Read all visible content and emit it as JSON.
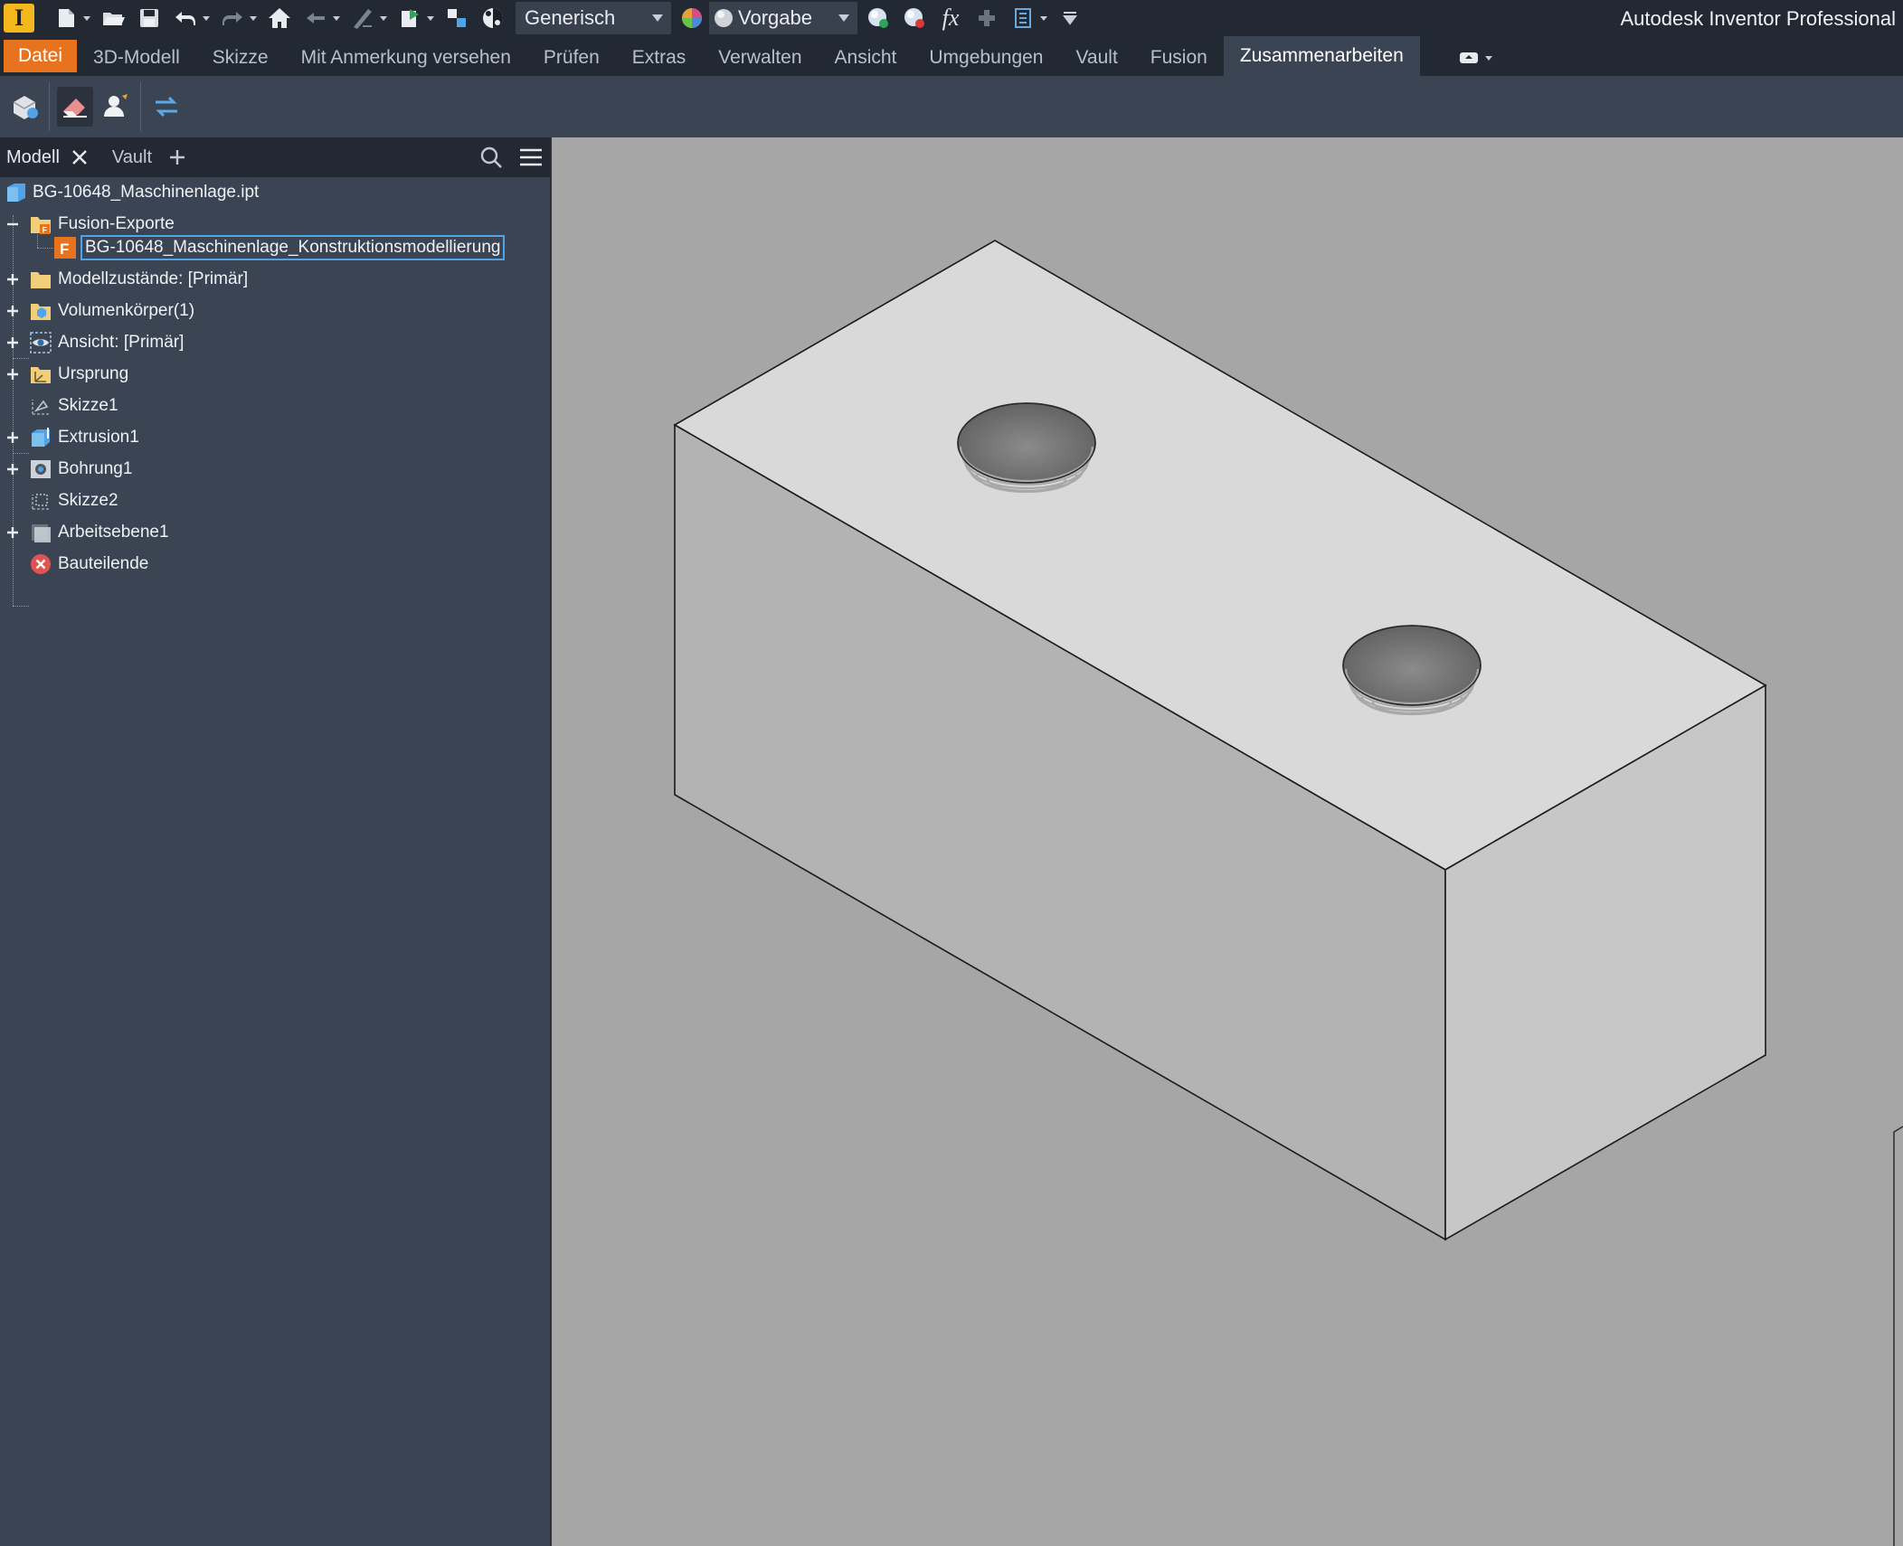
{
  "app": {
    "logo_letter": "I",
    "title": "Autodesk Inventor Professional"
  },
  "quick_access": {
    "appearance_combo": "Generisch",
    "material_combo": "Vorgabe",
    "fx_label": "fx"
  },
  "ribbon": {
    "tabs": [
      "Datei",
      "3D-Modell",
      "Skizze",
      "Mit Anmerkung versehen",
      "Prüfen",
      "Extras",
      "Verwalten",
      "Ansicht",
      "Umgebungen",
      "Vault",
      "Fusion",
      "Zusammenarbeiten"
    ],
    "active_tab": "Zusammenarbeiten"
  },
  "browser": {
    "tabs": [
      "Modell",
      "Vault"
    ],
    "tree": {
      "root": "BG-10648_Maschinenlage.ipt",
      "fusion_folder": "Fusion-Exporte",
      "fusion_item": "BG-10648_Maschinenlage_Konstruktionsmodellierung",
      "model_states": "Modellzustände: [Primär]",
      "solid_bodies": "Volumenkörper(1)",
      "view": "Ansicht: [Primär]",
      "origin": "Ursprung",
      "sketch1": "Skizze1",
      "extrusion1": "Extrusion1",
      "hole1": "Bohrung1",
      "sketch2": "Skizze2",
      "workplane1": "Arbeitsebene1",
      "end_of_part": "Bauteilende"
    }
  },
  "colors": {
    "title_bar": "#222933",
    "panel": "#3b4453",
    "file_tab": "#e8731e",
    "viewport": "#a6a6a6",
    "selection": "#4fa3e6"
  }
}
